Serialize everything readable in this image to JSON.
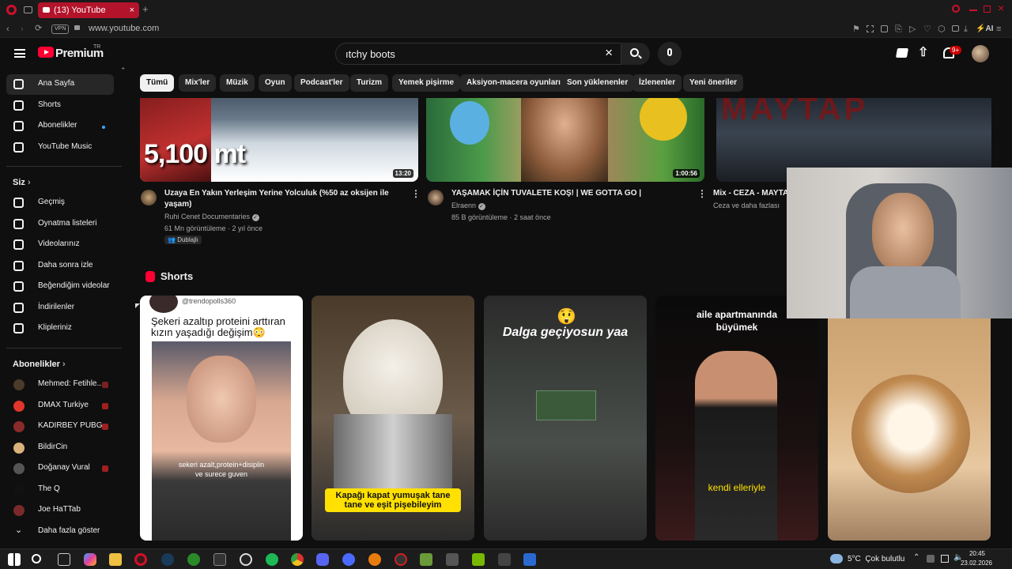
{
  "browser": {
    "tab_title": "(13) YouTube",
    "tab_close": "×",
    "new_tab": "+",
    "vpn_label": "VPN",
    "url": "www.youtube.com",
    "ai_label": "AI"
  },
  "header": {
    "logo_text": "Premium",
    "logo_region": "TR",
    "search_value": "ıtchy boots",
    "notif_count": "9+"
  },
  "chips": [
    "Tümü",
    "Mix'ler",
    "Müzik",
    "Oyun",
    "Podcast'ler",
    "Turizm",
    "Yemek pişirme",
    "Aksiyon-macera oyunları",
    "Son yüklenenler",
    "İzlenenler",
    "Yeni öneriler"
  ],
  "sidebar": {
    "main": [
      "Ana Sayfa",
      "Shorts",
      "Abonelikler",
      "YouTube Music"
    ],
    "you_heading": "Siz",
    "you": [
      "Geçmiş",
      "Oynatma listeleri",
      "Videolarınız",
      "Daha sonra izle",
      "Beğendiğim videolar",
      "İndirilenler",
      "Klipleriniz"
    ],
    "subs_heading": "Abonelikler",
    "subs": [
      {
        "name": "Mehmed: Fetihle...",
        "color": "#4a3b2a"
      },
      {
        "name": "DMAX Turkiye",
        "color": "#e0362b"
      },
      {
        "name": "KADIRBEY PUBG",
        "color": "#8b2a2a"
      },
      {
        "name": "BildirCin",
        "color": "#d8b27a"
      },
      {
        "name": "Doğanay Vural",
        "color": "#555555"
      },
      {
        "name": "The Q",
        "color": "#111111"
      },
      {
        "name": "Joe HaTTab",
        "color": "#7a2a2a"
      }
    ],
    "show_more": "Daha fazla göster"
  },
  "videos": [
    {
      "title": "Uzaya En Yakın Yerleşim Yerine Yolculuk (%50 az oksijen ile yaşam)",
      "channel": "Ruhi Cenet Documentaries",
      "meta": "61 Mn görüntüleme · 2 yıl önce",
      "badge": "Dublajlı",
      "duration": "13:20",
      "overlay": "5,100 mt"
    },
    {
      "title": "YAŞAMAK İÇİN TUVALETE KOŞ! | WE GOTTA GO |",
      "channel": "Elraenn",
      "meta": "85 B görüntüleme · 2 saat önce",
      "duration": "1:00:56"
    },
    {
      "title": "Mix - CEZA - MAYTA",
      "channel": "Ceza ve daha fazlası",
      "overlay": "MAYTAP"
    }
  ],
  "shorts_heading": "Shorts",
  "shorts": [
    {
      "handle": "@trendopolls360",
      "caption": "Şekeri azaltıp proteini arttıran kızın yaşadığı değişim😳",
      "inner": "sekeri azalt,protein+disiplin ve surece guven"
    },
    {
      "caption": "Kapağı kapat yumuşak tane tane ve eşit pişebileyim"
    },
    {
      "emoji": "😲",
      "caption": "Dalga geçiyosun yaa"
    },
    {
      "caption": "aile apartmanında büyümek",
      "sub": "kendi elleriyle"
    },
    {}
  ],
  "taskbar": {
    "weather": "5°C  Çok bulutlu",
    "time": "20:45",
    "date": "23.02.2026"
  },
  "colors": {
    "brand": "#ff0033",
    "tab": "#b3142b",
    "bg": "#0f0f0f"
  }
}
